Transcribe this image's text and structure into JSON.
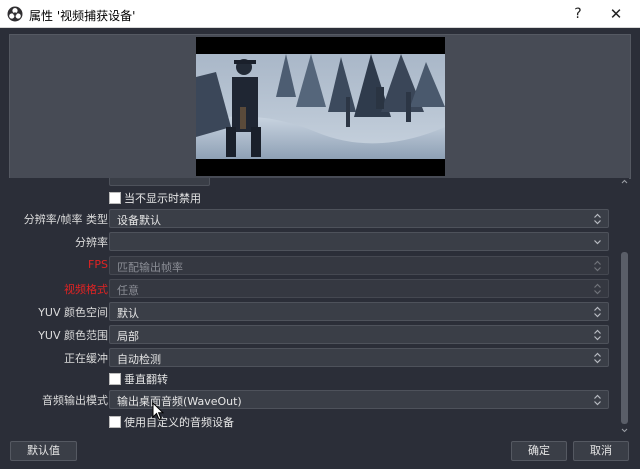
{
  "window": {
    "title": "属性 '视频捕获设备'",
    "help_label": "?",
    "close_label": "✕",
    "icon": "obs-logo-icon"
  },
  "preview": {
    "content": "snowy-forest-game-scene"
  },
  "properties": {
    "disable_when_not_showing": {
      "label": "当不显示时禁用",
      "checked": false
    },
    "resolution_fps_type": {
      "label": "分辨率/帧率 类型",
      "value": "设备默认"
    },
    "resolution": {
      "label": "分辨率",
      "value": ""
    },
    "fps": {
      "label": "FPS",
      "value": "匹配输出帧率"
    },
    "video_format": {
      "label": "视频格式",
      "value": "任意"
    },
    "yuv_color_space": {
      "label": "YUV 颜色空间",
      "value": "默认"
    },
    "yuv_color_range": {
      "label": "YUV 颜色范围",
      "value": "局部"
    },
    "buffering": {
      "label": "正在缓冲",
      "value": "自动检测"
    },
    "flip_vertically": {
      "label": "垂直翻转",
      "checked": false
    },
    "audio_output_mode": {
      "label": "音频输出模式",
      "value": "输出桌面音频(WaveOut)"
    },
    "use_custom_audio_device": {
      "label": "使用自定义的音频设备",
      "checked": false
    }
  },
  "buttons": {
    "defaults": "默认值",
    "ok": "确定",
    "cancel": "取消"
  },
  "colors": {
    "background": "#2b2e38",
    "warning_label": "#e12323",
    "field": "#3a3e47"
  }
}
